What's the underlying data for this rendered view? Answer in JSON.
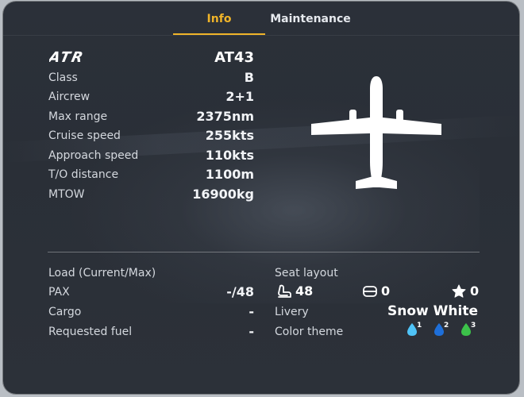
{
  "tabs": [
    {
      "label": "Info",
      "active": true
    },
    {
      "label": "Maintenance",
      "active": false
    }
  ],
  "aircraft": {
    "brand_logo": "ATR",
    "model": "AT43"
  },
  "specs": [
    {
      "label": "Class",
      "value": "B"
    },
    {
      "label": "Aircrew",
      "value": "2+1"
    },
    {
      "label": "Max range",
      "value": "2375nm"
    },
    {
      "label": "Cruise speed",
      "value": "255kts"
    },
    {
      "label": "Approach speed",
      "value": "110kts"
    },
    {
      "label": "T/O distance",
      "value": "1100m"
    },
    {
      "label": "MTOW",
      "value": "16900kg"
    }
  ],
  "load": {
    "title": "Load (Current/Max)",
    "rows": [
      {
        "label": "PAX",
        "value": "-/48"
      },
      {
        "label": "Cargo",
        "value": "-"
      },
      {
        "label": "Requested fuel",
        "value": "-"
      }
    ]
  },
  "seat_layout": {
    "title": "Seat layout",
    "economy": {
      "icon": "economy-seat-icon",
      "count": "48"
    },
    "business": {
      "icon": "business-seat-icon",
      "count": "0"
    },
    "first": {
      "icon": "first-class-star-icon",
      "count": "0"
    }
  },
  "livery": {
    "label": "Livery",
    "value": "Snow White"
  },
  "color_theme": {
    "label": "Color theme",
    "options": [
      {
        "number": "1",
        "color": "#4fc3f7"
      },
      {
        "number": "2",
        "color": "#1e6fd9"
      },
      {
        "number": "3",
        "color": "#3cc24a"
      }
    ]
  },
  "colors": {
    "accent": "#f0b429",
    "panel": "#2b3039"
  }
}
